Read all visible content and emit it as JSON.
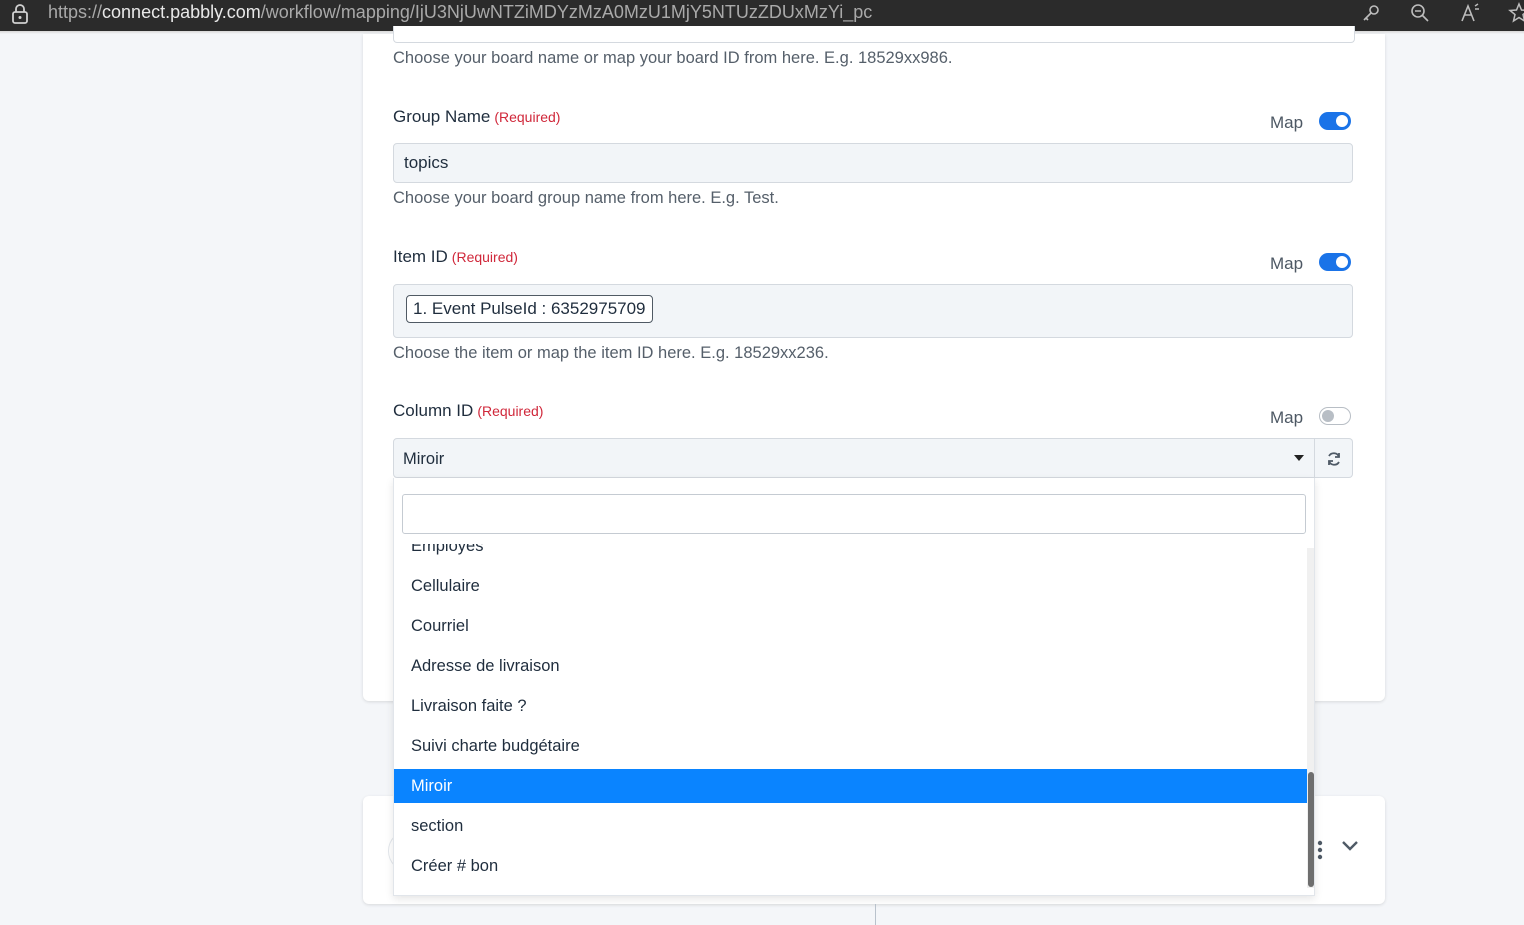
{
  "browser": {
    "url_prefix": "https://",
    "url_domain": "connect.pabbly.com",
    "url_path": "/workflow/mapping/IjU3NjUwNTZiMDYzMzA0MzU1MjY5NTUzZDUxMzYi_pc"
  },
  "fields": {
    "board": {
      "help": "Choose your board name or map your board ID from here. E.g. 18529xx986."
    },
    "group": {
      "label": "Group Name",
      "required": "(Required)",
      "map_label": "Map",
      "map_on": true,
      "value": "topics",
      "help": "Choose your board group name from here. E.g. Test."
    },
    "item": {
      "label": "Item ID",
      "required": "(Required)",
      "map_label": "Map",
      "map_on": true,
      "chip": "1. Event PulseId : 6352975709",
      "help": "Choose the item or map the item ID here. E.g. 18529xx236."
    },
    "column": {
      "label": "Column ID",
      "required": "(Required)",
      "map_label": "Map",
      "map_on": false,
      "selected": "Miroir"
    }
  },
  "dropdown": {
    "search_placeholder": "",
    "options": [
      "Employés",
      "Cellulaire",
      "Courriel",
      "Adresse de livraison",
      "Livraison faite ?",
      "Suivi charte budgétaire",
      "Miroir",
      "section",
      "Créer # bon"
    ],
    "selected_index": 6,
    "highlight_color": "#0a84ff"
  },
  "colors": {
    "toggle_on": "#1a73e8",
    "required": "#d0273a"
  }
}
